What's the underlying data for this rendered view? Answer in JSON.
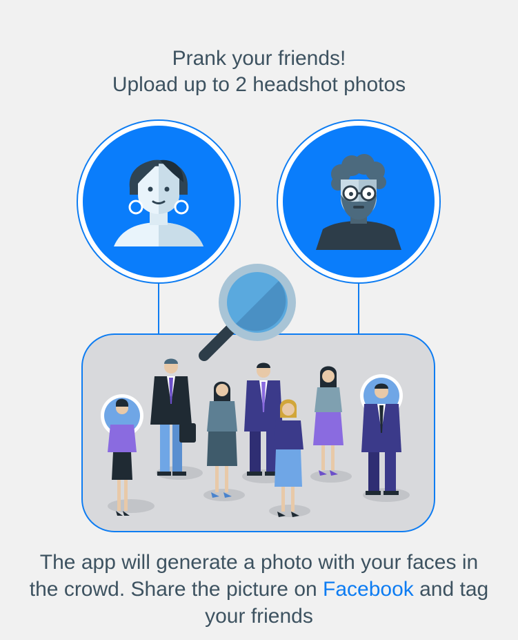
{
  "heading": {
    "line1": "Prank your friends!",
    "line2": "Upload up to 2 headshot photos"
  },
  "avatars": [
    {
      "name": "female-headshot",
      "icon": "woman-avatar-icon"
    },
    {
      "name": "male-headshot",
      "icon": "bearded-man-avatar-icon"
    }
  ],
  "crowd": {
    "icon": "crowd-of-people-illustration",
    "highlight_icon": "magnifying-glass-icon"
  },
  "footer": {
    "line1": "The app will generate a photo with your faces in",
    "line2_before": "the crowd. Share the picture on ",
    "link": "Facebook",
    "line2_after": " and tag",
    "line3": "your friends"
  },
  "colors": {
    "accent": "#0d7cf2",
    "avatar_bg": "#0a7dfb",
    "text": "#3d5260",
    "crowd_bg": "#d8d9dc"
  }
}
